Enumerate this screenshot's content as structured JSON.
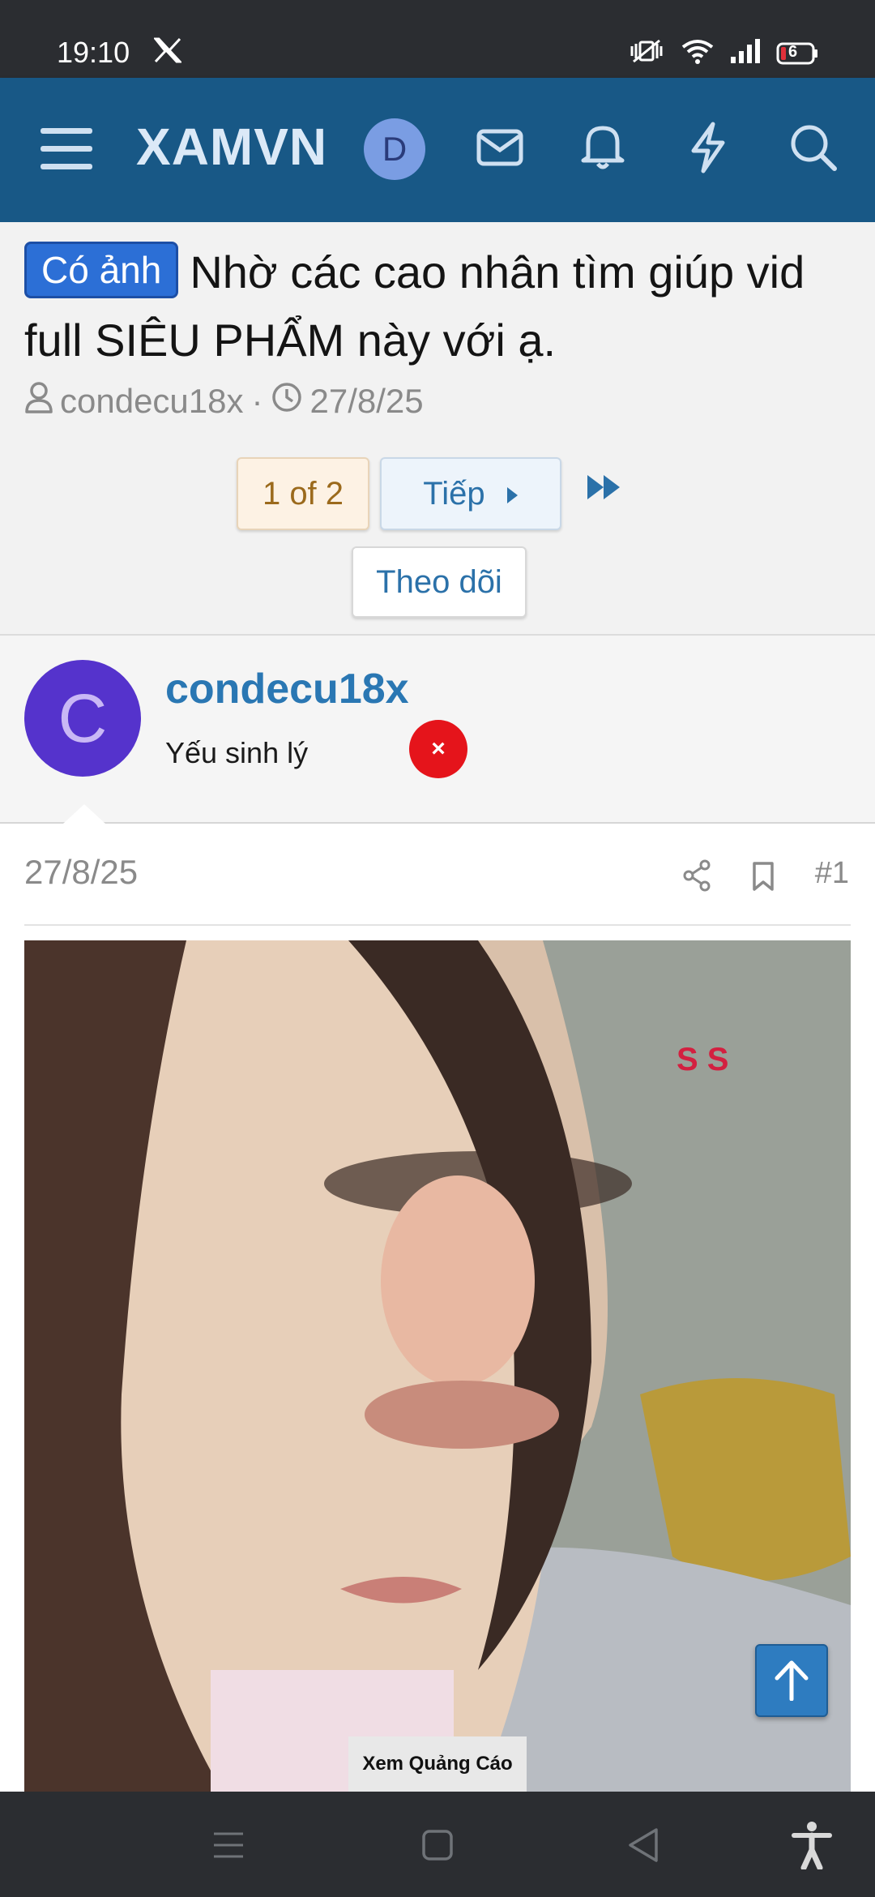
{
  "status_bar": {
    "time": "19:10",
    "battery": "6"
  },
  "header": {
    "logo": "XAMVN",
    "avatar_letter": "D"
  },
  "thread": {
    "badge": "Có ảnh",
    "title": "Nhờ các cao nhân tìm giúp vid full SIÊU PHẨM này với ạ.",
    "author": "condecu18x",
    "date": "27/8/25",
    "pagination": {
      "current": "1 of 2",
      "next": "Tiếp"
    },
    "follow": "Theo dõi"
  },
  "post_author": {
    "avatar_letter": "C",
    "name": "condecu18x",
    "user_title": "Yếu sinh lý"
  },
  "post": {
    "date": "27/8/25",
    "number": "#1",
    "ad_label": "Xem Quảng Cáo",
    "close_symbol": "×"
  },
  "colors": {
    "navbar": "#185886",
    "link": "#2a77b3",
    "badge": "#2c6fd6",
    "avatar": "#5533cc"
  }
}
